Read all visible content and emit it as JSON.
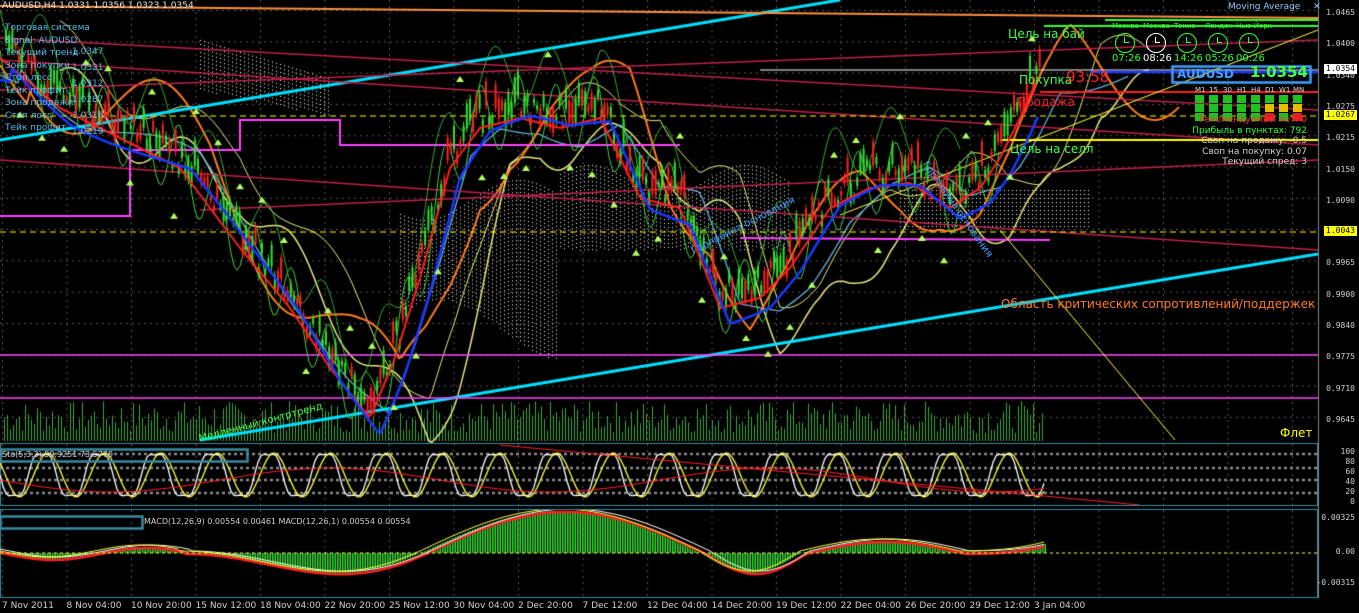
{
  "window": {
    "symbol_header": "AUDUSD,H4  1.0331 1.0356 1.0323 1.0354",
    "indicator_name": "Moving Average"
  },
  "price_axis": [
    "1.0465",
    "1.0400",
    "1.0340",
    "1.0275",
    "1.0215",
    "1.0150",
    "1.0090",
    "1.0025",
    "0.9965",
    "0.9900",
    "0.9840",
    "0.9775",
    "0.9710",
    "0.9645"
  ],
  "price_tags": [
    {
      "label": "1.0354",
      "fg": "#000000",
      "bg": "#ffffff"
    },
    {
      "label": "1.0267",
      "fg": "#000000",
      "bg": "#ffff00"
    },
    {
      "label": "1.0043",
      "fg": "#000000",
      "bg": "#ffff00"
    }
  ],
  "time_axis": [
    "7 Nov 2011",
    "8 Nov 04:00",
    "10 Nov 20:00",
    "15 Nov 12:00",
    "18 Nov 04:00",
    "22 Nov 20:00",
    "25 Nov 12:00",
    "30 Nov 04:00",
    "2 Dec 20:00",
    "7 Dec 12:00",
    "12 Dec 04:00",
    "14 Dec 20:00",
    "19 Dec 12:00",
    "22 Dec 04:00",
    "26 Dec 20:00",
    "29 Dec 12:00",
    "3 Jan 04:00"
  ],
  "annotations": {
    "target_buy": "Цель на бай",
    "buy": "Покупка",
    "timer": "93:58",
    "sell": "Продажа",
    "target_sell": "Цель на селл",
    "neck_1": "Горловина основания",
    "neck_2": "Горловина основания",
    "critical_zone": "Область критических сопротивлений/поддержек",
    "countertrend": "Медленный контртренд",
    "flat": "Флет"
  },
  "left_panel": [
    "Торговая система",
    "Signal: AUDUSD",
    "Текущий тренд",
    "Зона покупки",
    "Стоп лосс",
    "Тейк профит",
    "Зона продажи",
    "Стоп лосс",
    "Тейк профит"
  ],
  "left_values": [
    "1.0347",
    "1.0321",
    "1.0312",
    "1.0287",
    "1.0316",
    "1.0219"
  ],
  "clocks": {
    "cities": [
      "Москва",
      "Москва",
      "Токио",
      "Лондон",
      "Нью-Йорк"
    ],
    "times": [
      "07:26",
      "08:26",
      "14:26",
      "05:26",
      "00:26"
    ]
  },
  "symbol_box": {
    "symbol": "AUDUSD",
    "price": "1.0354"
  },
  "timeframes": [
    "M1",
    "15",
    "30",
    "H1",
    "H4",
    "D1",
    "W1",
    "MN"
  ],
  "info_panel": [
    {
      "text": "Рекомендуемый лот: 0",
      "color": "#ff3030"
    },
    {
      "text": "Прибыль в пунктах: 792",
      "color": "#30ff30"
    },
    {
      "text": "Своп на продажу: -0.5",
      "color": "#d0d0d0"
    },
    {
      "text": "Своп на покупку: 0.07",
      "color": "#d0d0d0"
    },
    {
      "text": "Текущий спред: 3",
      "color": "#d0d0d0"
    }
  ],
  "stochastic": {
    "title": "Sto(5,3,3) 59.9251 73.5770",
    "axis": [
      "100",
      "80",
      "60",
      "40",
      "20",
      "0"
    ]
  },
  "macd": {
    "title": "MACD(12,26,9) 0.00554 0.00461  MACD(12,26,1) 0.00554 0.00554",
    "axis": [
      "0.00325",
      "0.00",
      "-0.00315"
    ]
  },
  "colors": {
    "bull": "#30e030",
    "bear": "#ff2020",
    "cyan": "#00e0ff",
    "orange": "#ff7a20",
    "magenta": "#ff40ff",
    "yellow": "#ffff80",
    "blue": "#1838ff",
    "crimson": "#c0204a"
  }
}
